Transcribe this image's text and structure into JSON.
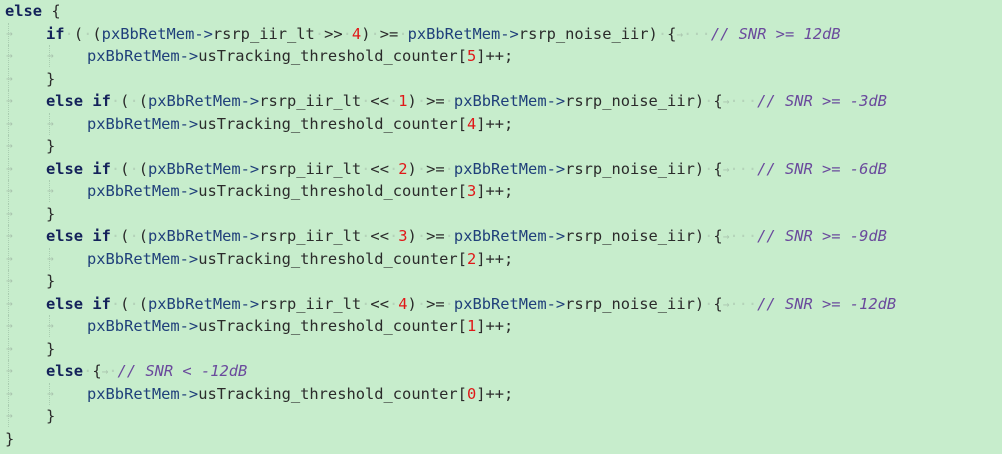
{
  "code": {
    "else_kw": "else",
    "if_kw": "if",
    "else_if_kw": "else if",
    "open_brace": "{",
    "close_brace": "}",
    "open_paren": "(",
    "close_paren": ")",
    "ptr": "pxBbRetMem->",
    "iir_lt": "rsrp_iir_lt",
    "noise_iir": "rsrp_noise_iir",
    "counter": "usTracking_threshold_counter",
    "op_ge": ">=",
    "op_shr": ">>",
    "op_shl": "<<",
    "incr": "++;",
    "tab_marker": "→",
    "branches": [
      {
        "shift": "4",
        "comment": "// SNR >= 12dB",
        "index": "5"
      },
      {
        "shift": "1",
        "comment": "// SNR >= -3dB",
        "index": "4"
      },
      {
        "shift": "2",
        "comment": "// SNR >= -6dB",
        "index": "3"
      },
      {
        "shift": "3",
        "comment": "// SNR >= -9dB",
        "index": "2"
      },
      {
        "shift": "4",
        "comment": "// SNR >= -12dB",
        "index": "1"
      }
    ],
    "else_branch": {
      "comment": "// SNR < -12dB",
      "index": "0"
    }
  },
  "colors": {
    "background": "#c7edcc",
    "keyword": "#14225a",
    "number": "#e01818",
    "comment": "#6a4a9c"
  }
}
